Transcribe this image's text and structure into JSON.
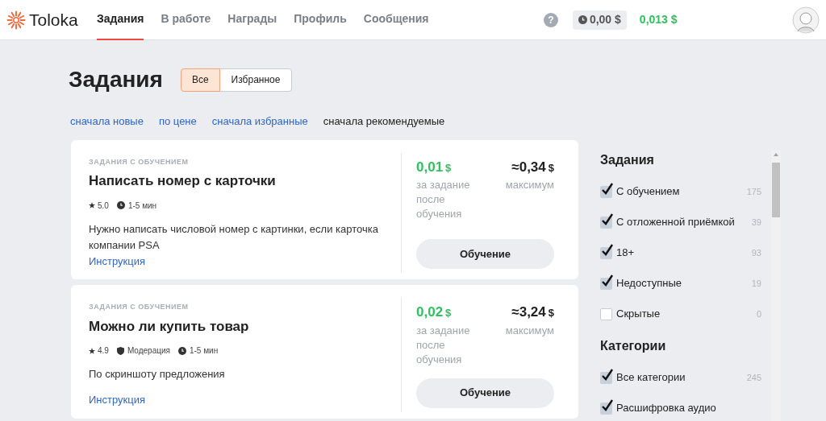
{
  "header": {
    "logo": "Toloka",
    "nav": [
      {
        "label": "Задания",
        "selected": true
      },
      {
        "label": "В работе",
        "selected": false
      },
      {
        "label": "Награды",
        "selected": false
      },
      {
        "label": "Профиль",
        "selected": false
      },
      {
        "label": "Сообщения",
        "selected": false
      }
    ],
    "help": "?",
    "balance": "0,00 $",
    "earned": "0,013 $"
  },
  "page": {
    "title": "Задания",
    "filter": [
      {
        "label": "Все",
        "selected": true
      },
      {
        "label": "Избранное",
        "selected": false
      }
    ],
    "sort": [
      {
        "label": "сначала новые",
        "selected": false
      },
      {
        "label": "по цене",
        "selected": false
      },
      {
        "label": "сначала избранные",
        "selected": false
      },
      {
        "label": "сначала рекомендуемые",
        "selected": true
      }
    ]
  },
  "tasks": [
    {
      "tag": "ЗАДАНИЯ С ОБУЧЕНИЕМ",
      "title": "Написать номер с карточки",
      "rating": "5.0",
      "time": "1-5 мин",
      "description": "Нужно написать числовой номер с картинки, если карточка компании PSA",
      "link": "Инструкция",
      "price": "0,01",
      "price_note": "за задание после обучения",
      "max": "≈0,34",
      "max_note": "максимум",
      "currency": "$",
      "button": "Обучение"
    },
    {
      "tag": "ЗАДАНИЯ С ОБУЧЕНИЕМ",
      "title": "Можно ли купить товар",
      "rating": "4.9",
      "moderation": "Модерация",
      "time": "1-5 мин",
      "description": "По скриншоту предложения",
      "link": "Инструкция",
      "price": "0,02",
      "price_note": "за задание после обучения",
      "max": "≈3,24",
      "max_note": "максимум",
      "currency": "$",
      "button": "Обучение"
    }
  ],
  "filters": [
    {
      "title": "Задания",
      "items": [
        {
          "label": "С обучением",
          "count": "175",
          "checked": true
        },
        {
          "label": "С отложенной приёмкой",
          "count": "39",
          "checked": true
        },
        {
          "label": "18+",
          "count": "93",
          "checked": true
        },
        {
          "label": "Недоступные",
          "count": "19",
          "checked": true
        },
        {
          "label": "Скрытые",
          "count": "0",
          "checked": false
        }
      ]
    },
    {
      "title": "Категории",
      "items": [
        {
          "label": "Все категории",
          "count": "245",
          "checked": true
        },
        {
          "label": "Расшифровка аудио",
          "checked": true
        }
      ]
    }
  ]
}
